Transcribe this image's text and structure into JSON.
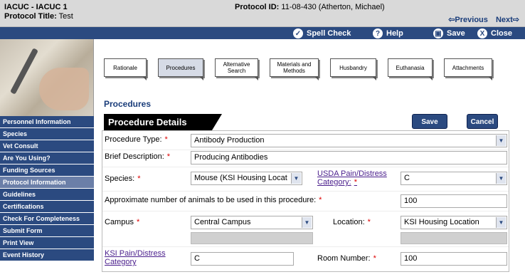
{
  "header": {
    "title": "IACUC - IACUC 1",
    "protocol_title_label": "Protocol Title:",
    "protocol_title_value": "Test",
    "protocol_id_label": "Protocol ID:",
    "protocol_id_value": "11-08-430 (Atherton, Michael)",
    "previous": "⇦Previous",
    "next": "Next⇨"
  },
  "actions": {
    "spell_check": "Spell Check",
    "help": "Help",
    "save": "Save",
    "close": "Close"
  },
  "sidebar": {
    "items": [
      {
        "label": "Personnel Information"
      },
      {
        "label": "Species"
      },
      {
        "label": "Vet Consult"
      },
      {
        "label": "Are You Using?"
      },
      {
        "label": "Funding Sources"
      },
      {
        "label": "Protocol Information"
      },
      {
        "label": "Guidelines"
      },
      {
        "label": "Certifications"
      },
      {
        "label": "Check For Completeness"
      },
      {
        "label": "Submit Form"
      },
      {
        "label": "Print View"
      },
      {
        "label": "Event History"
      }
    ]
  },
  "tabs": [
    {
      "label": "Rationale"
    },
    {
      "label": "Procedures"
    },
    {
      "label": "Alternative Search"
    },
    {
      "label": "Materials and Methods"
    },
    {
      "label": "Husbandry"
    },
    {
      "label": "Euthanasia"
    },
    {
      "label": "Attachments"
    }
  ],
  "section_heading": "Procedures",
  "banner": "Procedure Details",
  "buttons": {
    "save": "Save",
    "cancel": "Cancel"
  },
  "form": {
    "procedure_type_label": "Procedure Type:",
    "procedure_type_value": "Antibody Production",
    "brief_desc_label": "Brief Description:",
    "brief_desc_value": "Producing Antibodies",
    "species_label": "Species:",
    "species_value": "Mouse (KSI Housing Locat",
    "usda_label": "USDA Pain/Distress Category:",
    "usda_value": "C",
    "approx_label": "Approximate number of animals to be used in this procedure:",
    "approx_value": "100",
    "campus_label": "Campus",
    "campus_value": "Central Campus",
    "location_label": "Location:",
    "location_value": "KSI Housing Location",
    "ksi_label": "KSI Pain/Distress Category",
    "ksi_value": "C",
    "room_label": "Room Number:",
    "room_value": "100",
    "required_mark": "*"
  }
}
